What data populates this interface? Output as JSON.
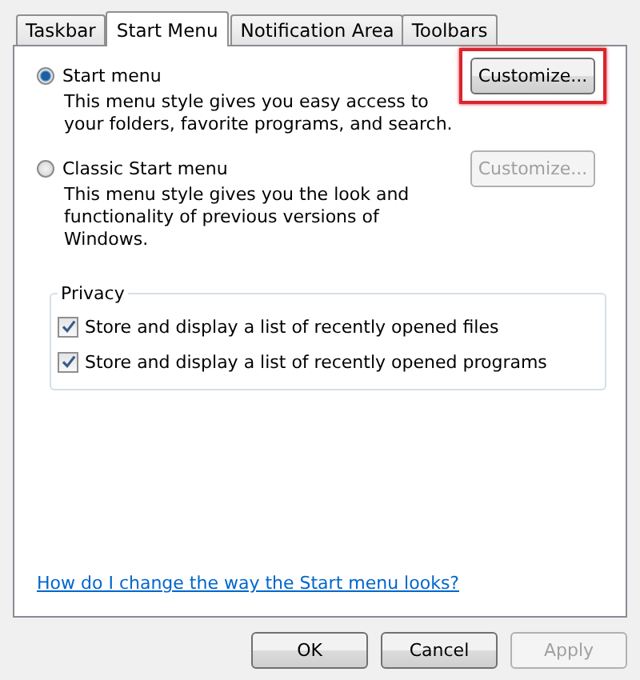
{
  "tabs": [
    {
      "label": "Taskbar",
      "selected": false
    },
    {
      "label": "Start Menu",
      "selected": true
    },
    {
      "label": "Notification Area",
      "selected": false
    },
    {
      "label": "Toolbars",
      "selected": false
    }
  ],
  "options": [
    {
      "label": "Start menu",
      "selected": true,
      "description": "This menu style gives you easy access to your folders, favorite programs, and search.",
      "button": {
        "label": "Customize...",
        "disabled": false,
        "highlighted": true
      }
    },
    {
      "label": "Classic Start menu",
      "selected": false,
      "description": "This menu style gives you the look and functionality of previous versions of Windows.",
      "button": {
        "label": "Customize...",
        "disabled": true,
        "highlighted": false
      }
    }
  ],
  "privacy": {
    "title": "Privacy",
    "items": [
      {
        "label": "Store and display a list of recently opened files",
        "checked": true
      },
      {
        "label": "Store and display a list of recently opened programs",
        "checked": true
      }
    ]
  },
  "help_link": "How do I change the way the Start menu looks?",
  "buttons": [
    {
      "label": "OK",
      "disabled": false
    },
    {
      "label": "Cancel",
      "disabled": false
    },
    {
      "label": "Apply",
      "disabled": true
    }
  ]
}
